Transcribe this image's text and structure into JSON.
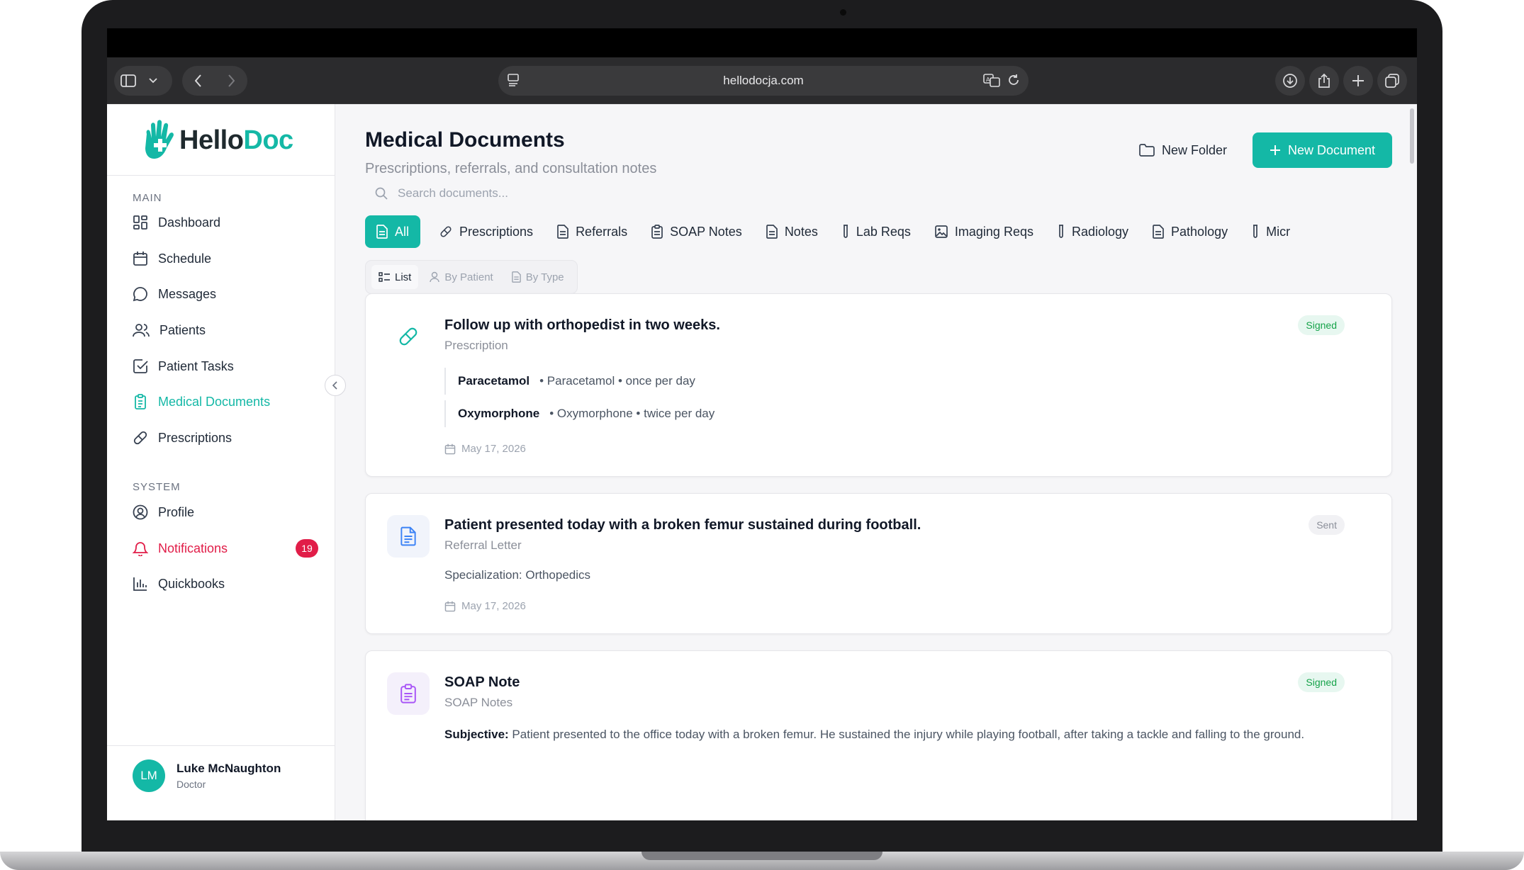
{
  "browser": {
    "url": "hellodocja.com"
  },
  "logo": {
    "part1": "Hello",
    "part2": "Doc"
  },
  "sidebar": {
    "main_label": "MAIN",
    "system_label": "SYSTEM",
    "main_items": [
      {
        "label": "Dashboard",
        "icon": "dashboard-icon"
      },
      {
        "label": "Schedule",
        "icon": "calendar-icon"
      },
      {
        "label": "Messages",
        "icon": "message-icon"
      },
      {
        "label": "Patients",
        "icon": "users-icon"
      },
      {
        "label": "Patient Tasks",
        "icon": "checkbox-icon"
      },
      {
        "label": "Medical Documents",
        "icon": "clipboard-icon",
        "active": true
      },
      {
        "label": "Prescriptions",
        "icon": "pill-icon"
      }
    ],
    "system_items": [
      {
        "label": "Profile",
        "icon": "user-circle-icon"
      },
      {
        "label": "Notifications",
        "icon": "bell-icon",
        "badge": "19"
      },
      {
        "label": "Quickbooks",
        "icon": "bar-chart-icon"
      }
    ],
    "user": {
      "initials": "LM",
      "name": "Luke McNaughton",
      "role": "Doctor"
    }
  },
  "header": {
    "title": "Medical Documents",
    "subtitle": "Prescriptions, referrals, and consultation notes",
    "new_folder": "New Folder",
    "new_document": "New Document"
  },
  "search": {
    "placeholder": "Search documents..."
  },
  "tabs": [
    "All",
    "Prescriptions",
    "Referrals",
    "SOAP Notes",
    "Notes",
    "Lab Reqs",
    "Imaging Reqs",
    "Radiology",
    "Pathology",
    "Micr"
  ],
  "view_modes": [
    "List",
    "By Patient",
    "By Type"
  ],
  "documents": [
    {
      "title": "Follow up with orthopedist in two weeks.",
      "type": "Prescription",
      "status": "Signed",
      "medications": [
        {
          "name": "Paracetamol",
          "detail": "• Paracetamol • once per day"
        },
        {
          "name": "Oxymorphone",
          "detail": "• Oxymorphone • twice per day"
        }
      ],
      "date": "May 17, 2026"
    },
    {
      "title": "Patient presented today with a broken femur sustained during football.",
      "type": "Referral Letter",
      "status": "Sent",
      "specialization": "Specialization: Orthopedics",
      "date": "May 17, 2026"
    },
    {
      "title": "SOAP Note",
      "type": "SOAP Notes",
      "status": "Signed",
      "subjective_label": "Subjective:",
      "subjective_text": " Patient presented to the office today with a broken femur. He sustained the injury while playing football, after taking a tackle and falling to the ground."
    }
  ],
  "colors": {
    "accent": "#14b8a6",
    "alert": "#e11d48",
    "signed_bg": "#e7f7f0",
    "signed_text": "#16a34a"
  }
}
